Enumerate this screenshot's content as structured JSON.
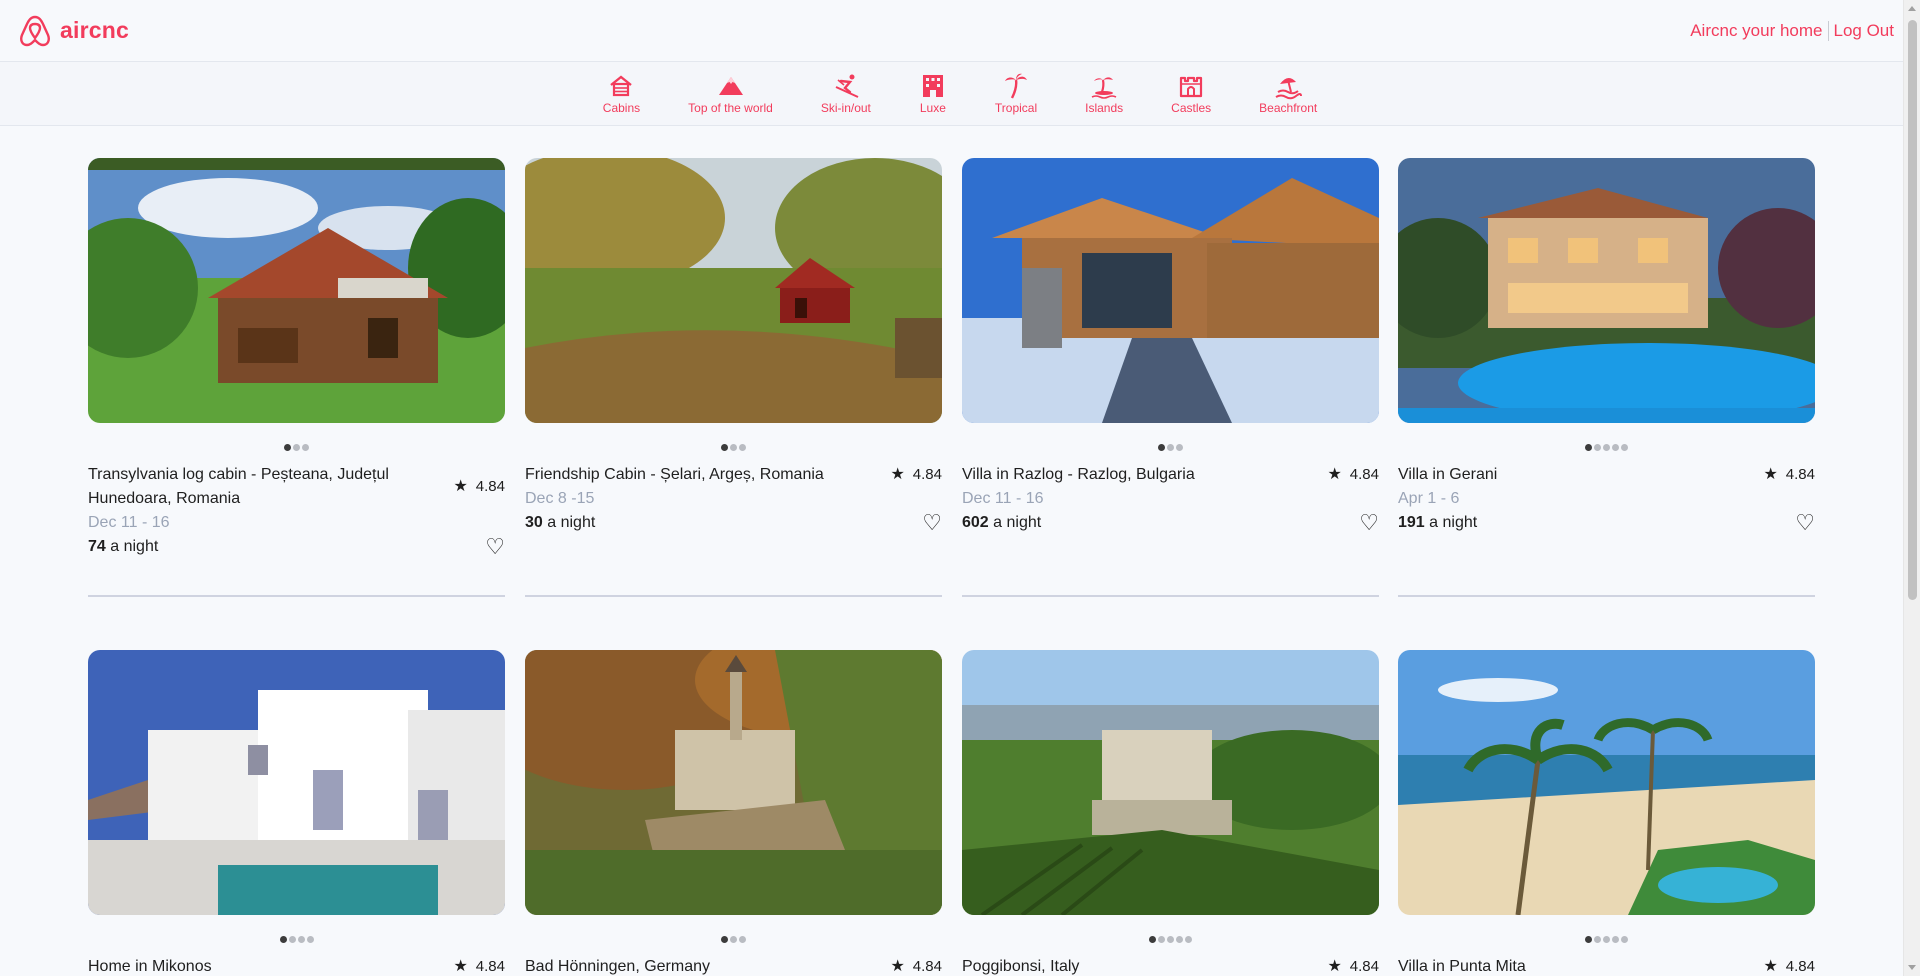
{
  "app": {
    "name": "aircnc",
    "brand_color": "#f23c5c"
  },
  "topnav": {
    "host_label": "Aircnc your home",
    "logout_label": "Log Out"
  },
  "categories": [
    {
      "label": "Cabins",
      "icon": "cabin-icon"
    },
    {
      "label": "Top of the world",
      "icon": "mountain-icon"
    },
    {
      "label": "Ski-in/out",
      "icon": "skier-icon"
    },
    {
      "label": "Luxe",
      "icon": "building-icon"
    },
    {
      "label": "Tropical",
      "icon": "palm-tree-icon"
    },
    {
      "label": "Islands",
      "icon": "island-icon"
    },
    {
      "label": "Castles",
      "icon": "castle-icon"
    },
    {
      "label": "Beachfront",
      "icon": "beach-icon"
    }
  ],
  "listings": [
    {
      "title": "Transylvania log cabin - Peșteana, Județul Hunedoara, Romania",
      "rating": "4.84",
      "dates": "Dec 11 - 16",
      "price": "74",
      "price_suffix": " a night",
      "photos": 3,
      "active_photo": 0,
      "photo_theme": "log-cabin"
    },
    {
      "title": "Friendship Cabin - Șelari, Argeș, Romania",
      "rating": "4.84",
      "dates": "Dec 8 -15",
      "price": "30",
      "price_suffix": " a night",
      "photos": 3,
      "active_photo": 0,
      "photo_theme": "red-cabin"
    },
    {
      "title": "Villa in Razlog - Razlog, Bulgaria",
      "rating": "4.84",
      "dates": "Dec 11 - 16",
      "price": "602",
      "price_suffix": " a night",
      "photos": 3,
      "active_photo": 0,
      "photo_theme": "chalet"
    },
    {
      "title": "Villa in Gerani",
      "rating": "4.84",
      "dates": "Apr 1 - 6",
      "price": "191",
      "price_suffix": " a night",
      "photos": 6,
      "active_photo": 0,
      "photo_theme": "pool-villa"
    },
    {
      "title": "Home in Mikonos",
      "rating": "4.84",
      "photos": 5,
      "active_photo": 0,
      "photo_theme": "white-house"
    },
    {
      "title": "Bad Hönningen, Germany",
      "rating": "4.84",
      "photos": 3,
      "active_photo": 0,
      "photo_theme": "castle-vineyard"
    },
    {
      "title": "Poggibonsi, Italy",
      "rating": "4.84",
      "photos": 6,
      "active_photo": 0,
      "photo_theme": "italian-villa"
    },
    {
      "title": "Villa in Punta Mita",
      "rating": "4.84",
      "photos": 6,
      "active_photo": 0,
      "photo_theme": "beach-palms"
    }
  ]
}
